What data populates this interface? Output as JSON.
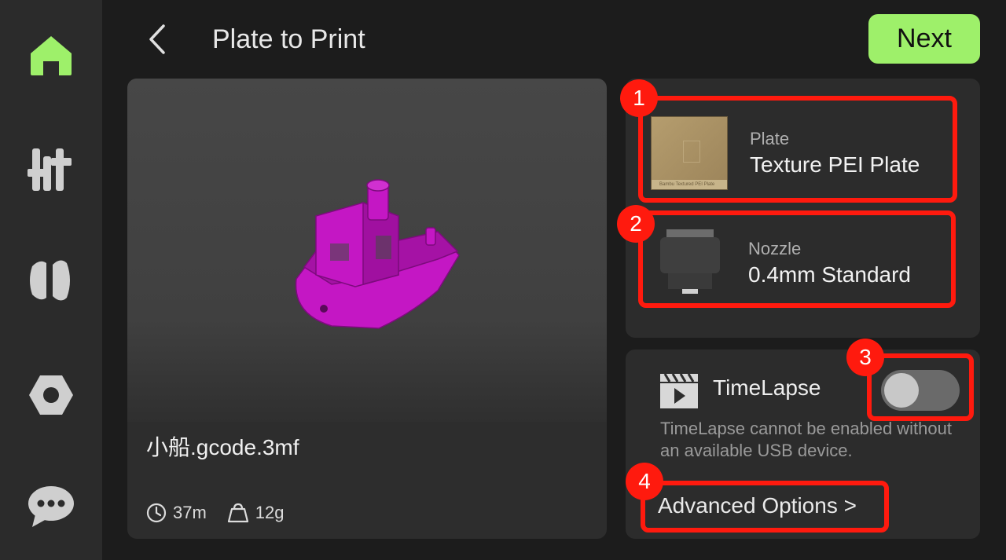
{
  "header": {
    "title": "Plate to Print",
    "next_label": "Next"
  },
  "sidebar": {
    "items": [
      {
        "icon": "home-icon",
        "active": true
      },
      {
        "icon": "controls-icon",
        "active": false
      },
      {
        "icon": "filament-icon",
        "active": false
      },
      {
        "icon": "settings-icon",
        "active": false
      },
      {
        "icon": "messages-icon",
        "active": false
      }
    ]
  },
  "job": {
    "file_name": "小船.gcode.3mf",
    "time": "37m",
    "weight": "12g"
  },
  "plate": {
    "label": "Plate",
    "value": "Texture PEI Plate",
    "thumb_caption": "Bambu Textured PEI Plate"
  },
  "nozzle": {
    "label": "Nozzle",
    "value": "0.4mm Standard"
  },
  "timelapse": {
    "label": "TimeLapse",
    "enabled": false,
    "note": "TimeLapse cannot be enabled without an available USB device."
  },
  "advanced": {
    "label": "Advanced Options >"
  },
  "annotations": [
    "1",
    "2",
    "3",
    "4"
  ],
  "colors": {
    "accent": "#9ef06a",
    "highlight": "#ff1a0e",
    "model": "#c417c4"
  }
}
